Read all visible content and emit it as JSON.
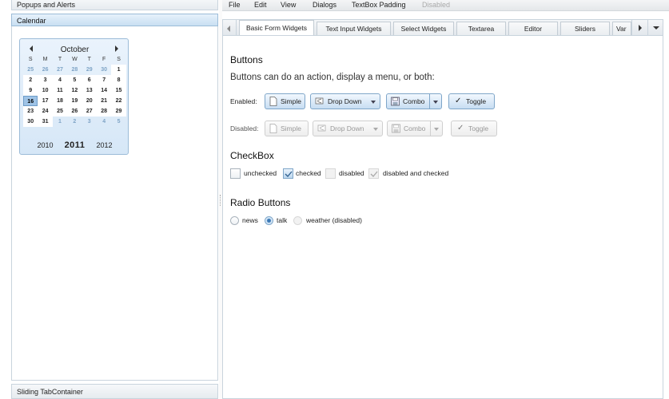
{
  "left": {
    "popups_title": "Popups and Alerts",
    "calendar_title": "Calendar",
    "sliding_title": "Sliding TabContainer"
  },
  "calendar": {
    "month": "October",
    "weekdays": [
      "S",
      "M",
      "T",
      "W",
      "T",
      "F",
      "S"
    ],
    "weeks": [
      [
        "25",
        "26",
        "27",
        "28",
        "29",
        "30",
        "1"
      ],
      [
        "2",
        "3",
        "4",
        "5",
        "6",
        "7",
        "8"
      ],
      [
        "9",
        "10",
        "11",
        "12",
        "13",
        "14",
        "15"
      ],
      [
        "16",
        "17",
        "18",
        "19",
        "20",
        "21",
        "22"
      ],
      [
        "23",
        "24",
        "25",
        "26",
        "27",
        "28",
        "29"
      ],
      [
        "30",
        "31",
        "1",
        "2",
        "3",
        "4",
        "5"
      ]
    ],
    "today": "16",
    "years": {
      "prev": "2010",
      "current": "2011",
      "next": "2012"
    }
  },
  "menu": {
    "file": "File",
    "edit": "Edit",
    "view": "View",
    "dialogs": "Dialogs",
    "textbox_padding": "TextBox Padding",
    "disabled": "Disabled"
  },
  "tabs": [
    "Basic Form Widgets",
    "Text Input Widgets",
    "Select Widgets",
    "Textarea",
    "Editor",
    "Sliders",
    "Var"
  ],
  "buttons_section": {
    "title": "Buttons",
    "description": "Buttons can do an action, display a menu, or both:",
    "enabled_label": "Enabled:",
    "disabled_label": "Disabled:",
    "simple": "Simple",
    "drop_down": "Drop Down",
    "combo": "Combo",
    "toggle": "Toggle"
  },
  "checkbox_section": {
    "title": "CheckBox",
    "unchecked": "unchecked",
    "checked": "checked",
    "disabled": "disabled",
    "disabled_checked": "disabled and checked"
  },
  "radio_section": {
    "title": "Radio Buttons",
    "news": "news",
    "talk": "talk",
    "weather": "weather (disabled)"
  }
}
